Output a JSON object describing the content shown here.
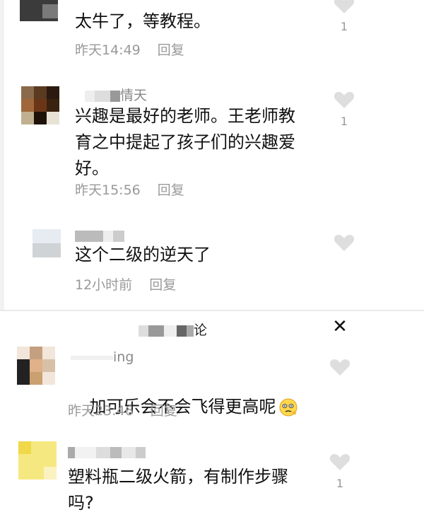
{
  "top_comments": [
    {
      "body": "太牛了，等教程。",
      "time": "昨天14:49",
      "reply_label": "回复",
      "like_count": "1"
    },
    {
      "username": "情天",
      "body": "兴趣是最好的老师。王老师教\n育之中提起了孩子们的兴趣爱\n好。",
      "time": "昨天15:56",
      "reply_label": "回复",
      "like_count": "1"
    },
    {
      "body": "这个二级的逆天了",
      "time": "12小时前",
      "reply_label": "回复"
    }
  ],
  "comments_header": {
    "title_suffix": "论"
  },
  "bottom_comments": [
    {
      "username": "ing",
      "body": "加可乐会不会飞得更高呢",
      "time": "昨天23:46",
      "reply_label": "回复"
    },
    {
      "body": "塑料瓶二级火箭，有制作步骤\n吗?",
      "like_count": "1"
    }
  ],
  "icons": {
    "like": "heart-icon",
    "close": "close-icon",
    "emoji": "thinking-emoji-icon"
  },
  "colors": {
    "text": "#111111",
    "meta": "#999999",
    "heart": "#dedede"
  }
}
